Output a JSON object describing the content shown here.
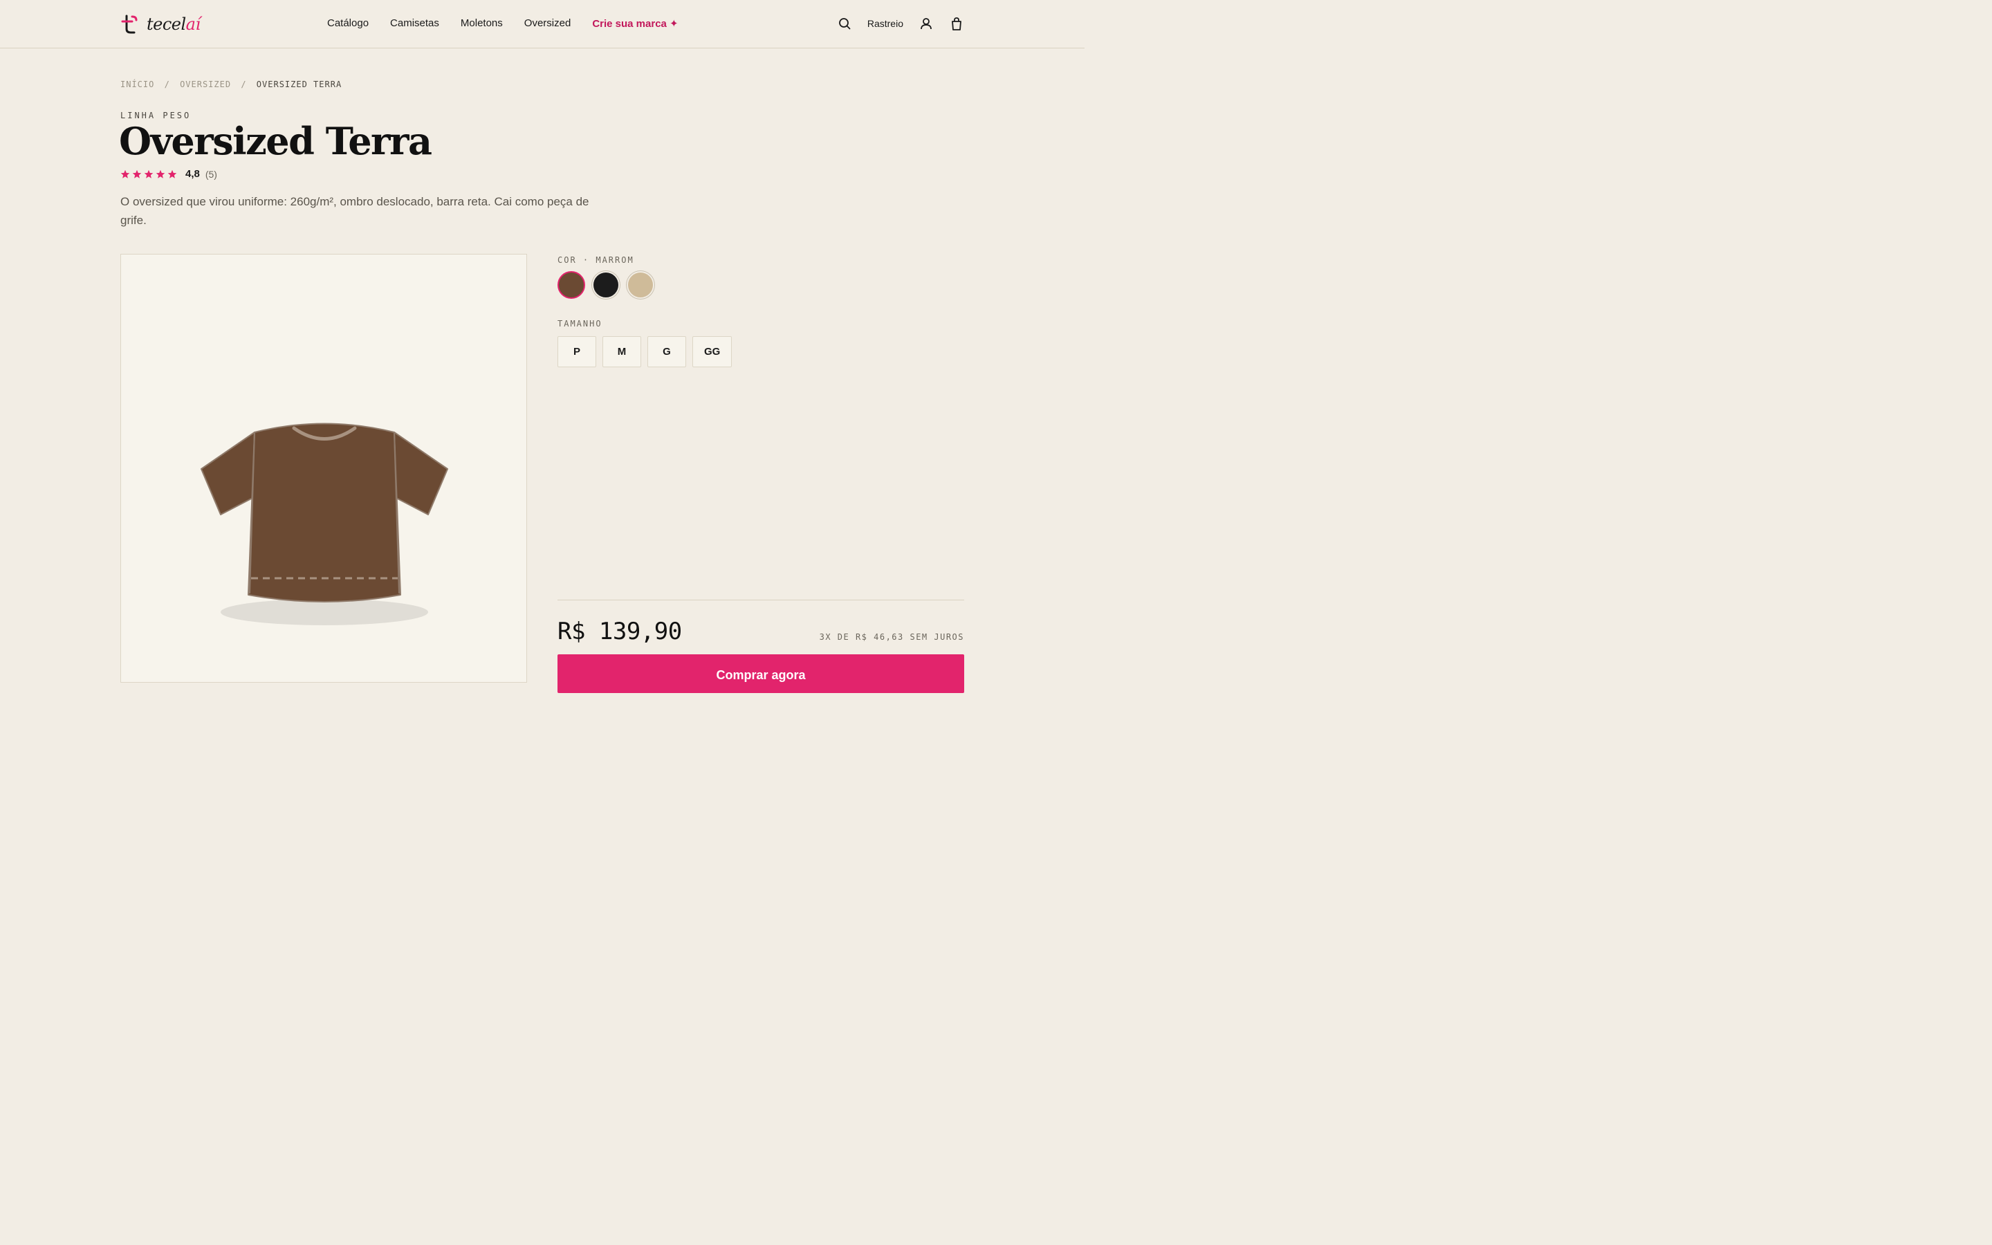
{
  "brand": {
    "name_part1": "tecel",
    "name_part2": "aí"
  },
  "nav": {
    "items": [
      "Catálogo",
      "Camisetas",
      "Moletons",
      "Oversized"
    ],
    "cta": "Crie sua marca ✦"
  },
  "header_right": {
    "tracking_label": "Rastreio",
    "icons": [
      "search-icon",
      "user-icon",
      "bag-icon"
    ]
  },
  "breadcrumb": {
    "items": [
      "INÍCIO",
      "OVERSIZED",
      "OVERSIZED TERRA"
    ],
    "separator": "/"
  },
  "product": {
    "line": "LINHA PESO",
    "title": "Oversized Terra",
    "rating": {
      "value": "4,8",
      "count": "(5)",
      "stars": 5
    },
    "description": "O oversized que virou uniforme: 260g/m², ombro deslocado, barra reta. Cai como peça de grife.",
    "color_label": "COR · MARROM",
    "colors": [
      {
        "name": "Marrom",
        "hex": "#6b4a33",
        "selected": true
      },
      {
        "name": "Preto",
        "hex": "#1c1c1c",
        "selected": false
      },
      {
        "name": "Areia",
        "hex": "#cfbb99",
        "selected": false
      }
    ],
    "size_label": "TAMANHO",
    "sizes": [
      "P",
      "M",
      "G",
      "GG"
    ],
    "price": "R$ 139,90",
    "installments": "3X DE R$ 46,63 SEM JUROS",
    "buy_label": "Comprar agora"
  },
  "colors": {
    "accent": "#e2246c",
    "background": "#f2ede4",
    "shirt": "#6b4a33"
  }
}
